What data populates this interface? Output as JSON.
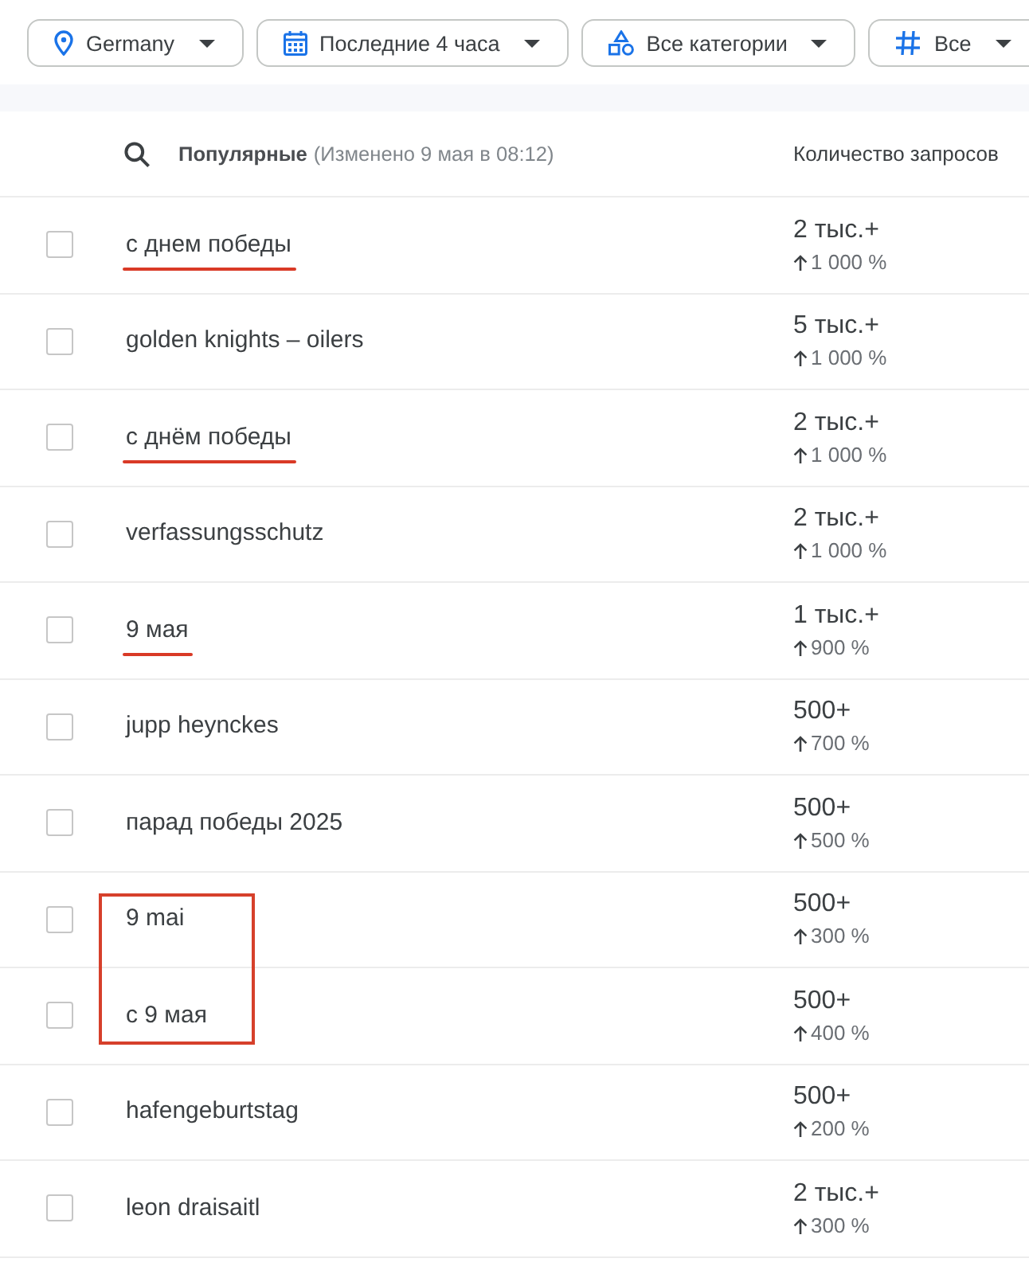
{
  "filters": [
    {
      "kind": "location",
      "label": "Germany"
    },
    {
      "kind": "date",
      "label": "Последние 4 часа"
    },
    {
      "kind": "category",
      "label": "Все категории"
    },
    {
      "kind": "type",
      "label": "Все"
    }
  ],
  "table": {
    "header": {
      "title": "Популярные",
      "updated": "(Изменено 9 мая в 08:12)",
      "column_heading": "Количество запросов"
    },
    "rows": [
      {
        "query": "с днем победы",
        "volume": "2 тыс.+",
        "growth": "1 000 %",
        "checked": false,
        "underlined": true,
        "boxed": false
      },
      {
        "query": "golden knights – oilers",
        "volume": "5 тыс.+",
        "growth": "1 000 %",
        "checked": false,
        "underlined": false,
        "boxed": false
      },
      {
        "query": "с днём победы",
        "volume": "2 тыс.+",
        "growth": "1 000 %",
        "checked": false,
        "underlined": true,
        "boxed": false
      },
      {
        "query": "verfassungsschutz",
        "volume": "2 тыс.+",
        "growth": "1 000 %",
        "checked": false,
        "underlined": false,
        "boxed": false
      },
      {
        "query": "9 мая",
        "volume": "1 тыс.+",
        "growth": "900 %",
        "checked": false,
        "underlined": true,
        "boxed": false
      },
      {
        "query": "jupp heynckes",
        "volume": "500+",
        "growth": "700 %",
        "checked": false,
        "underlined": false,
        "boxed": false
      },
      {
        "query": "парад победы 2025",
        "volume": "500+",
        "growth": "500 %",
        "checked": false,
        "underlined": false,
        "boxed": false
      },
      {
        "query": "9 mai",
        "volume": "500+",
        "growth": "300 %",
        "checked": false,
        "underlined": false,
        "boxed": true
      },
      {
        "query": "с 9 мая",
        "volume": "500+",
        "growth": "400 %",
        "checked": false,
        "underlined": false,
        "boxed": true
      },
      {
        "query": "hafengeburtstag",
        "volume": "500+",
        "growth": "200 %",
        "checked": false,
        "underlined": false,
        "boxed": false
      },
      {
        "query": "leon draisaitl",
        "volume": "2 тыс.+",
        "growth": "300 %",
        "checked": false,
        "underlined": false,
        "boxed": false
      }
    ]
  }
}
